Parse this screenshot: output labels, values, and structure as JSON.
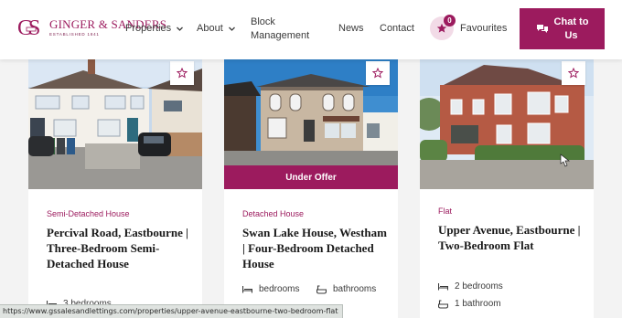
{
  "brand": {
    "name": "GINGER & SANDERS",
    "tagline": "ESTABLISHED 1841",
    "color": "#9c1b5e"
  },
  "nav": {
    "properties": "Properties",
    "about": "About",
    "block_management_line1": "Block",
    "block_management_line2": "Management",
    "news": "News",
    "contact": "Contact"
  },
  "favourites": {
    "count": "0",
    "label": "Favourites"
  },
  "chat": {
    "line1": "Chat to",
    "line2": "Us"
  },
  "listings": [
    {
      "type": "Semi-Detached House",
      "title": "Percival Road, Eastbourne | Three-Bedroom Semi-Detached House",
      "features": [
        {
          "icon": "bed-icon",
          "text": "3 bedrooms"
        }
      ]
    },
    {
      "type": "Detached House",
      "badge": "Under Offer",
      "title": "Swan Lake House, Westham | Four-Bedroom Detached House",
      "features": [
        {
          "icon": "bed-icon",
          "text": "bedrooms"
        },
        {
          "icon": "bath-icon",
          "text": "bathrooms"
        }
      ]
    },
    {
      "type": "Flat",
      "title": "Upper Avenue, Eastbourne | Two-Bedroom Flat",
      "features": [
        {
          "icon": "bed-icon",
          "text": "2 bedrooms"
        },
        {
          "icon": "bath-icon",
          "text": "1 bathroom"
        }
      ]
    }
  ],
  "status_url": "https://www.gssalesandlettings.com/properties/upper-avenue-eastbourne-two-bedroom-flat"
}
